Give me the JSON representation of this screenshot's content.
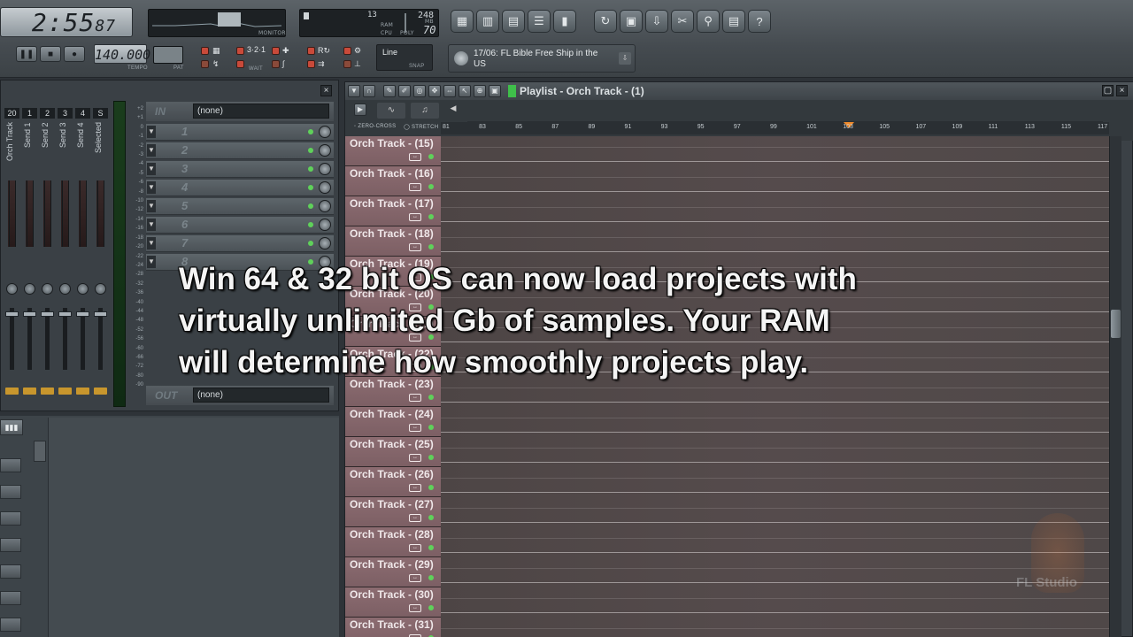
{
  "toolbar": {
    "song_time": "2:55",
    "song_time_ms": "87",
    "tempo": "140.000",
    "tempo_label": "TEMPO",
    "pat_label": "PAT",
    "monitor_label": "MONITOR",
    "cpu": {
      "ram_value": "13",
      "ram_label": "RAM",
      "poly_value": "248",
      "poly_sub": "70",
      "cpu_label": "CPU",
      "poly_label": "POLY",
      "mb_label": "MB"
    },
    "snap": {
      "value": "Line",
      "label": "SNAP"
    },
    "wait_label": "WAIT",
    "hint_text": "17/06: FL Bible Free Ship in the US"
  },
  "mixer": {
    "strips": [
      {
        "num": "20",
        "name": "Orch Track"
      },
      {
        "num": "1",
        "name": "Send 1"
      },
      {
        "num": "2",
        "name": "Send 2"
      },
      {
        "num": "3",
        "name": "Send 3"
      },
      {
        "num": "4",
        "name": "Send 4"
      },
      {
        "num": "S",
        "name": "Selected"
      }
    ],
    "in_label": "IN",
    "in_value": "(none)",
    "out_label": "OUT",
    "out_value": "(none)",
    "fx_slots": [
      "1",
      "2",
      "3",
      "4",
      "5",
      "6",
      "7",
      "8"
    ],
    "scale": [
      "+2",
      "+1",
      "0",
      "-1",
      "-2",
      "-3",
      "-4",
      "-5",
      "-6",
      "-8",
      "-10",
      "-12",
      "-14",
      "-16",
      "-18",
      "-20",
      "-22",
      "-24",
      "-28",
      "-32",
      "-36",
      "-40",
      "-44",
      "-48",
      "-52",
      "-56",
      "-60",
      "-66",
      "-72",
      "-80",
      "-90"
    ]
  },
  "playlist": {
    "title": "Playlist - Orch Track - (1)",
    "zero_cross_label": "ZERO-CROSS",
    "stretch_label": "STRETCH",
    "ruler": [
      "81",
      "83",
      "85",
      "87",
      "89",
      "91",
      "93",
      "95",
      "97",
      "99",
      "101",
      "103",
      "105",
      "107",
      "109",
      "111",
      "113",
      "115",
      "117"
    ],
    "tracks": [
      "Orch Track - (15)",
      "Orch Track - (16)",
      "Orch Track - (17)",
      "Orch Track - (18)",
      "Orch Track - (19)",
      "Orch Track - (20)",
      "Orch Track - (21)",
      "Orch Track - (22)",
      "Orch Track - (23)",
      "Orch Track - (24)",
      "Orch Track - (25)",
      "Orch Track - (26)",
      "Orch Track - (27)",
      "Orch Track - (28)",
      "Orch Track - (29)",
      "Orch Track - (30)",
      "Orch Track - (31)"
    ]
  },
  "caption": {
    "line1": "Win 64 & 32 bit OS can now load projects with",
    "line2": "virtually unlimited Gb of samples. Your RAM",
    "line3": "will determine how smoothly projects play."
  },
  "watermark": "FL Studio"
}
